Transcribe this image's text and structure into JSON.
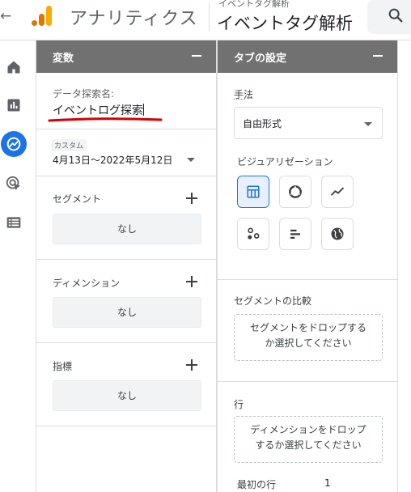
{
  "topbar": {
    "back_glyph": "←",
    "app_title": "アナリティクス",
    "breadcrumb_small": "イベントタグ解析",
    "breadcrumb_big": "イベントタグ解析",
    "search_icon": "search-icon"
  },
  "rail": {
    "items": [
      {
        "icon": "home-icon"
      },
      {
        "icon": "reports-icon"
      },
      {
        "icon": "explore-icon",
        "active": true
      },
      {
        "icon": "advertising-icon"
      },
      {
        "icon": "configure-icon"
      }
    ],
    "accent": "#1a73e8"
  },
  "variables_panel": {
    "title": "変数",
    "exploration_name_label": "データ探索名:",
    "exploration_name_value": "イベントログ探索",
    "date_chip": "カスタム",
    "date_range": "4月13日～2022年5月12日",
    "segments_label": "セグメント",
    "segments_empty": "なし",
    "dimensions_label": "ディメンション",
    "dimensions_empty": "なし",
    "metrics_label": "指標",
    "metrics_empty": "なし"
  },
  "tab_settings_panel": {
    "title": "タブの設定",
    "technique_label": "手法",
    "technique_value": "自由形式",
    "visualization_label": "ビジュアリゼーション",
    "visualizations": [
      {
        "icon": "table-icon",
        "selected": true
      },
      {
        "icon": "donut-chart-icon"
      },
      {
        "icon": "line-chart-icon"
      },
      {
        "icon": "scatter-plot-icon"
      },
      {
        "icon": "bar-chart-icon"
      },
      {
        "icon": "geo-map-icon"
      }
    ],
    "segment_comparison_label": "セグメントの比較",
    "segment_drop_text_1": "セグメントをドロップする",
    "segment_drop_text_2": "か選択してください",
    "rows_label": "行",
    "dimension_drop_text_1": "ディメンションをドロップ",
    "dimension_drop_text_2": "するか選択してください",
    "first_row_label": "最初の行",
    "first_row_value": "1"
  },
  "colors": {
    "panel_header": "#717171",
    "annotation_underline": "#d50000"
  }
}
